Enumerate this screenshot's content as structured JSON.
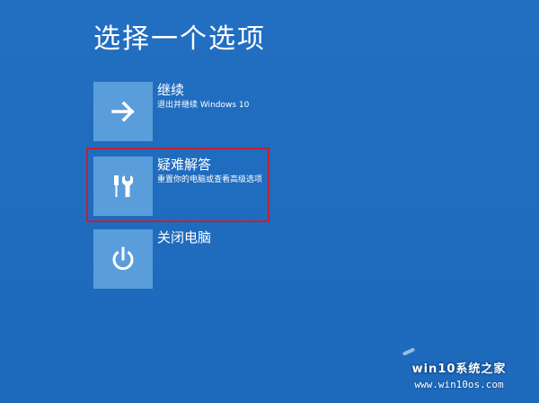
{
  "page": {
    "title": "选择一个选项"
  },
  "options": [
    {
      "label": "继续",
      "description": "退出并继续 Windows 10",
      "icon": "arrow-right-icon"
    },
    {
      "label": "疑难解答",
      "description": "重置你的电脑或查看高级选项",
      "icon": "tools-icon"
    },
    {
      "label": "关闭电脑",
      "description": "",
      "icon": "power-icon"
    }
  ],
  "highlight": {
    "target": "疑难解答",
    "color": "#c2202f"
  },
  "colors": {
    "background": "#1f6bbd",
    "tile": "#5a9ddb",
    "text": "#ffffff"
  },
  "watermark": {
    "title": "win10系统之家",
    "url": "www.win10os.com"
  }
}
